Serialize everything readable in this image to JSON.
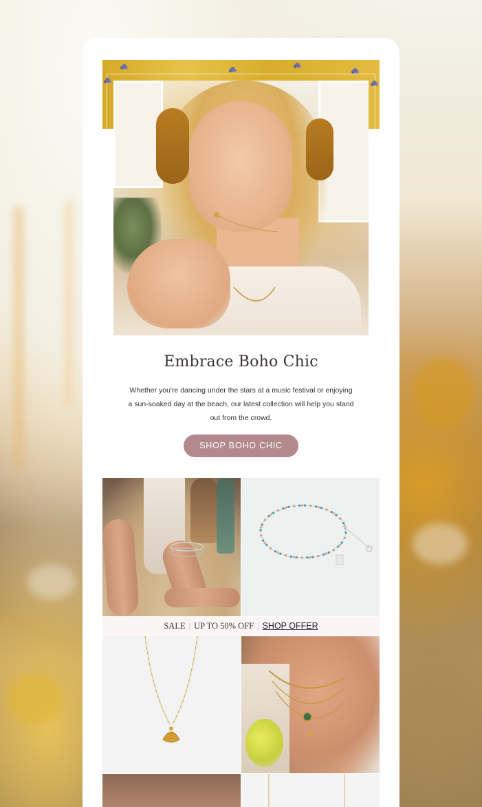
{
  "hero": {
    "title": "Embrace Boho Chic",
    "body": "Whether you're dancing under the stars at a music festival or enjoying a sun-soaked day at the beach, our latest collection will help you stand out from the crowd.",
    "cta_label": "SHOP BOHO CHIC"
  },
  "sale_bar": {
    "sale_label": "SALE",
    "discount_label": "UP TO 50% OFF",
    "link_label": "SHOP OFFER"
  },
  "colors": {
    "cta_background": "#b3898d",
    "sale_bar_background": "#fbf5f5",
    "gold_accent": "#d6a928"
  },
  "icons": {
    "hero_image": "woman-with-necklace-photo",
    "tile_1": "feet-with-anklet-photo",
    "tile_2": "beaded-anklet-product-photo",
    "tile_3": "shell-pendant-necklace-product-photo",
    "tile_4": "layered-necklaces-model-photo"
  }
}
